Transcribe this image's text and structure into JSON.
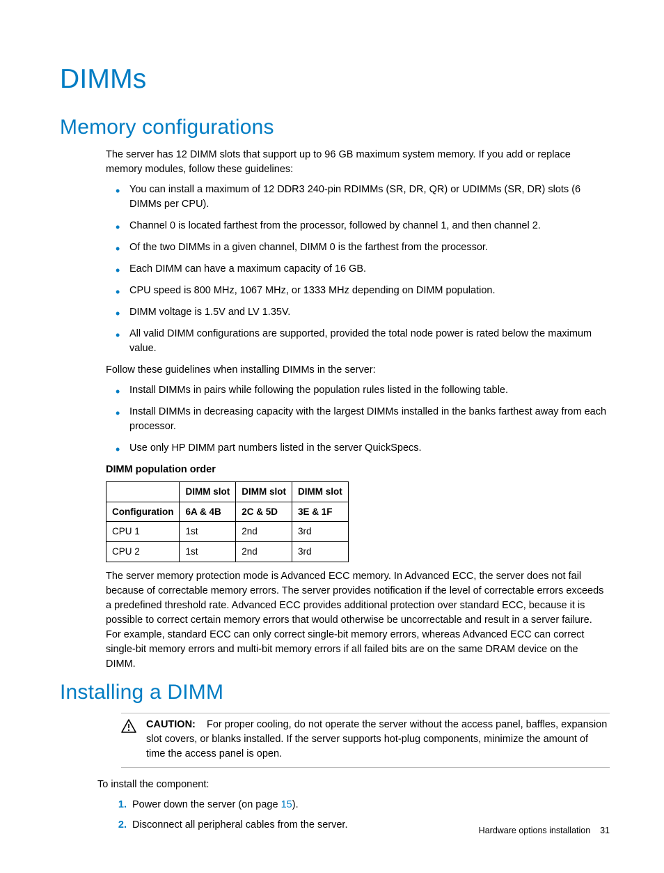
{
  "page": {
    "title": "DIMMs",
    "section1_heading": "Memory configurations",
    "intro": "The server has 12 DIMM slots that support up to 96 GB maximum system memory. If you add or replace memory modules, follow these guidelines:",
    "guidelines": [
      "You can install a maximum of 12 DDR3 240-pin RDIMMs (SR, DR, QR) or UDIMMs (SR, DR) slots (6 DIMMs per CPU).",
      "Channel 0 is located farthest from the processor, followed by channel 1, and then channel 2.",
      "Of the two DIMMs in a given channel, DIMM 0 is the farthest from the processor.",
      "Each DIMM can have a maximum capacity of 16 GB.",
      "CPU speed is 800 MHz, 1067 MHz, or 1333 MHz depending on DIMM population.",
      "DIMM voltage is 1.5V and LV 1.35V.",
      "All valid DIMM configurations are supported, provided the total node power is rated below the maximum value."
    ],
    "install_intro": "Follow these guidelines when installing DIMMs in the server:",
    "install_guidelines": [
      "Install DIMMs in pairs while following the population rules listed in the following table.",
      "Install DIMMs in decreasing capacity with the largest DIMMs installed in the banks farthest away from each processor.",
      "Use only HP DIMM part numbers listed in the server QuickSpecs."
    ],
    "table_title": "DIMM population order",
    "table": {
      "headers": [
        "",
        "DIMM slot",
        "DIMM slot",
        "DIMM slot"
      ],
      "subheaders": [
        "Configuration",
        "6A & 4B",
        "2C & 5D",
        "3E & 1F"
      ],
      "rows": [
        [
          "CPU 1",
          "1st",
          "2nd",
          "3rd"
        ],
        [
          "CPU 2",
          "1st",
          "2nd",
          "3rd"
        ]
      ]
    },
    "ecc_paragraph": "The server memory protection mode is Advanced ECC memory. In Advanced ECC, the server does not fail because of correctable memory errors. The server provides notification if the level of correctable errors exceeds a predefined threshold rate. Advanced ECC provides additional protection over standard ECC, because it is possible to correct certain memory errors that would otherwise be uncorrectable and result in a server failure. For example, standard ECC can only correct single-bit memory errors, whereas Advanced ECC can correct single-bit memory errors and multi-bit memory errors if all failed bits are on the same DRAM device on the DIMM.",
    "section2_heading": "Installing a DIMM",
    "caution": {
      "label": "CAUTION:",
      "text": "For proper cooling, do not operate the server without the access panel, baffles, expansion slot covers, or blanks installed. If the server supports hot-plug components, minimize the amount of time the access panel is open."
    },
    "install_steps_intro": "To install the component:",
    "install_steps": {
      "step1_pre": "Power down the server (on page ",
      "step1_link": "15",
      "step1_post": ").",
      "step2": "Disconnect all peripheral cables from the server."
    },
    "footer_text": "Hardware options installation",
    "footer_page": "31"
  }
}
